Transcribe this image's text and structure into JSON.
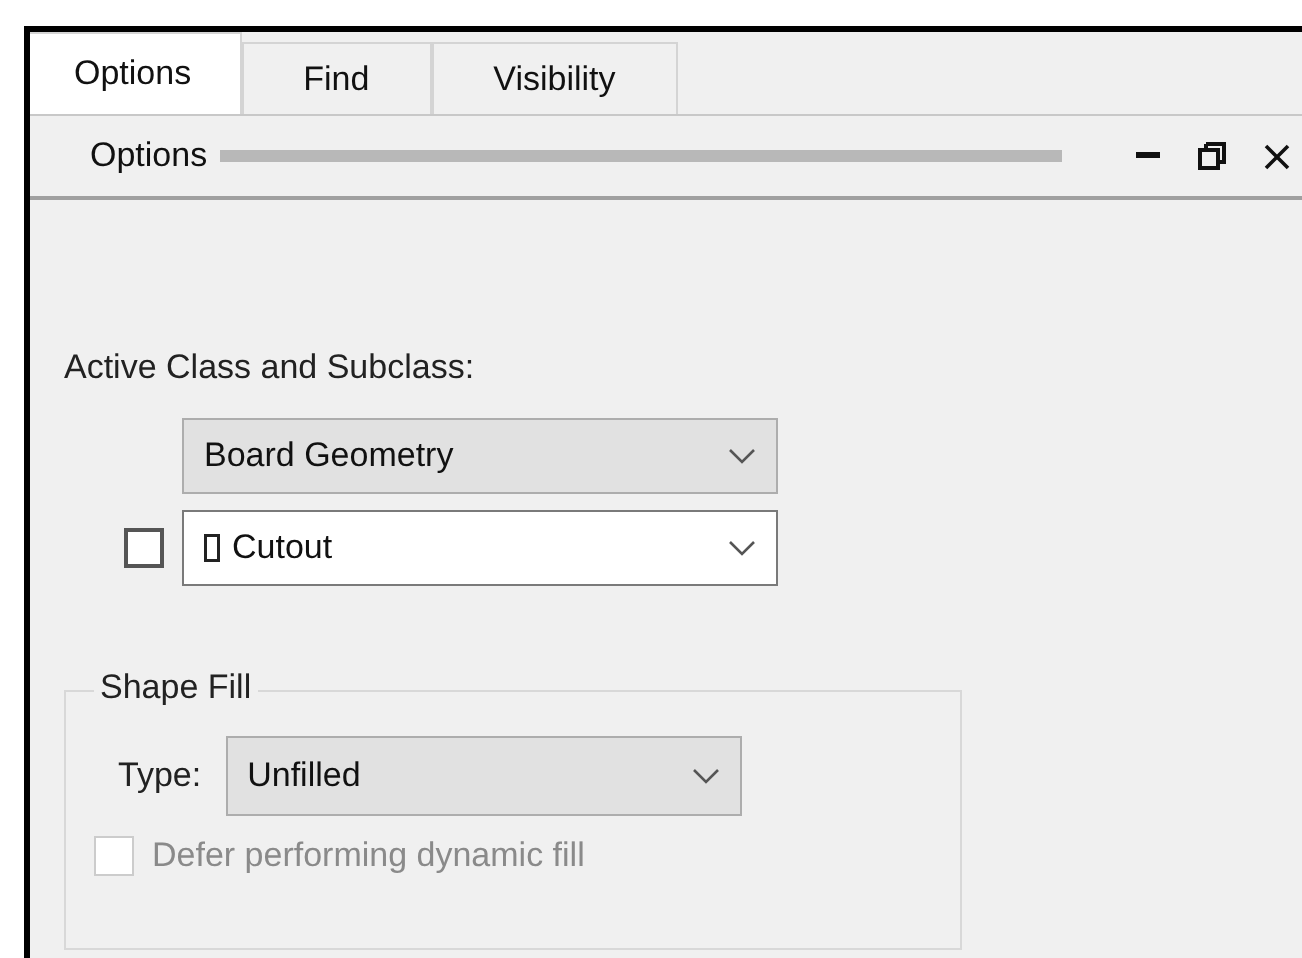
{
  "tabs": [
    {
      "label": "Options",
      "selected": true
    },
    {
      "label": "Find",
      "selected": false
    },
    {
      "label": "Visibility",
      "selected": false
    }
  ],
  "pane": {
    "title": "Options"
  },
  "active_class": {
    "label": "Active Class and Subclass:",
    "class_value": "Board Geometry",
    "subclass_checked": false,
    "subclass_value": "Cutout"
  },
  "shape_fill": {
    "title": "Shape Fill",
    "type_label": "Type:",
    "type_value": "Unfilled",
    "defer": {
      "label": "Defer performing dynamic fill",
      "checked": false,
      "disabled": true
    }
  }
}
